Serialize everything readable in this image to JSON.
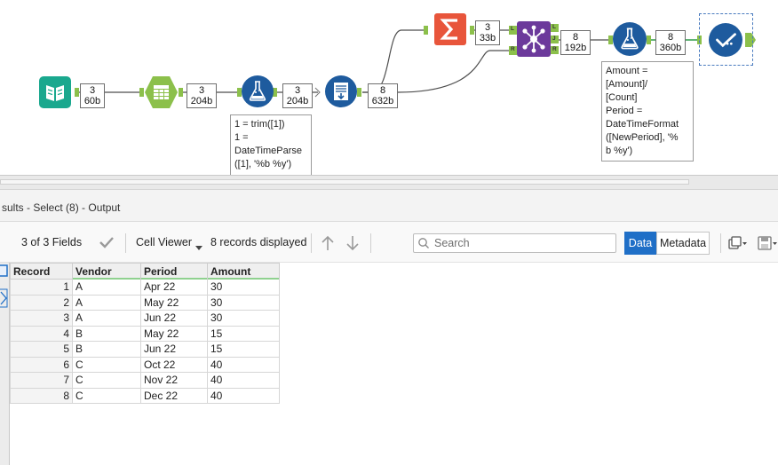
{
  "canvas": {
    "connection_badges": [
      {
        "count": "3",
        "size": "60b"
      },
      {
        "count": "3",
        "size": "204b"
      },
      {
        "count": "3",
        "size": "204b"
      },
      {
        "count": "8",
        "size": "632b"
      },
      {
        "count": "3",
        "size": "33b"
      },
      {
        "count": "8",
        "size": "192b"
      },
      {
        "count": "8",
        "size": "360b"
      }
    ],
    "annotations": {
      "formula_1": "1 = trim([1])\n1 =\nDateTimeParse\n([1], '%b %y')",
      "formula_2": "Amount =\n[Amount]/\n[Count]\nPeriod =\nDateTimeFormat\n([NewPeriod], '%\nb %y')"
    },
    "join_anchors": {
      "left": "L",
      "right": "R",
      "out_left": "L",
      "out_join": "J",
      "out_right": "R"
    },
    "colors": {
      "input_tool": "#1aa88e",
      "select_tool": "#8cc04b",
      "formula_tool": "#1e5b9e",
      "sort_tool": "#1e5b9e",
      "summarize_tool": "#e8553b",
      "join_tool": "#6c3a9b",
      "browse_tool": "#1e5b9e",
      "connection": "#4e4e4e",
      "anchor": "#8cc04b"
    }
  },
  "results": {
    "title": "sults - Select (8) - Output",
    "fields_label": "3 of 3 Fields",
    "cell_viewer_label": "Cell Viewer",
    "records_label": "8 records displayed",
    "search_placeholder": "Search",
    "data_tab": "Data",
    "metadata_tab": "Metadata",
    "accent": "#1f6fc7",
    "columns": [
      "Record",
      "Vendor",
      "Period",
      "Amount"
    ],
    "rows": [
      [
        "1",
        "A",
        "Apr 22",
        "30"
      ],
      [
        "2",
        "A",
        "May 22",
        "30"
      ],
      [
        "3",
        "A",
        "Jun 22",
        "30"
      ],
      [
        "4",
        "B",
        "May 22",
        "15"
      ],
      [
        "5",
        "B",
        "Jun 22",
        "15"
      ],
      [
        "6",
        "C",
        "Oct 22",
        "40"
      ],
      [
        "7",
        "C",
        "Nov 22",
        "40"
      ],
      [
        "8",
        "C",
        "Dec 22",
        "40"
      ]
    ]
  }
}
